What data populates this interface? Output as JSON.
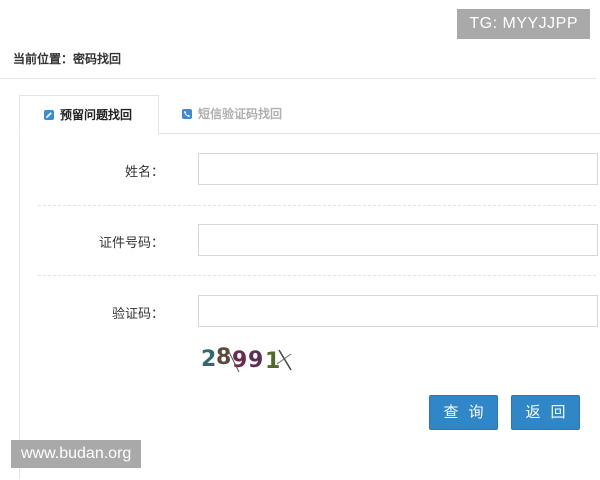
{
  "watermarks": {
    "top": "TG: MYYJJPP",
    "bottom": "www.budan.org"
  },
  "breadcrumb": {
    "text": "当前位置：密码找回"
  },
  "tabs": [
    {
      "label": "预留问题找回",
      "icon": "pencil-icon",
      "active": true
    },
    {
      "label": "短信验证码找回",
      "icon": "phone-icon",
      "active": false
    }
  ],
  "form": {
    "name_label": "姓名：",
    "id_label": "证件号码：",
    "captcha_label": "验证码：",
    "name_value": "",
    "id_value": "",
    "captcha_value": "",
    "captcha_image_text": "28991"
  },
  "buttons": {
    "query": "查询",
    "back": "返回"
  },
  "colors": {
    "accent": "#2f87c8"
  }
}
